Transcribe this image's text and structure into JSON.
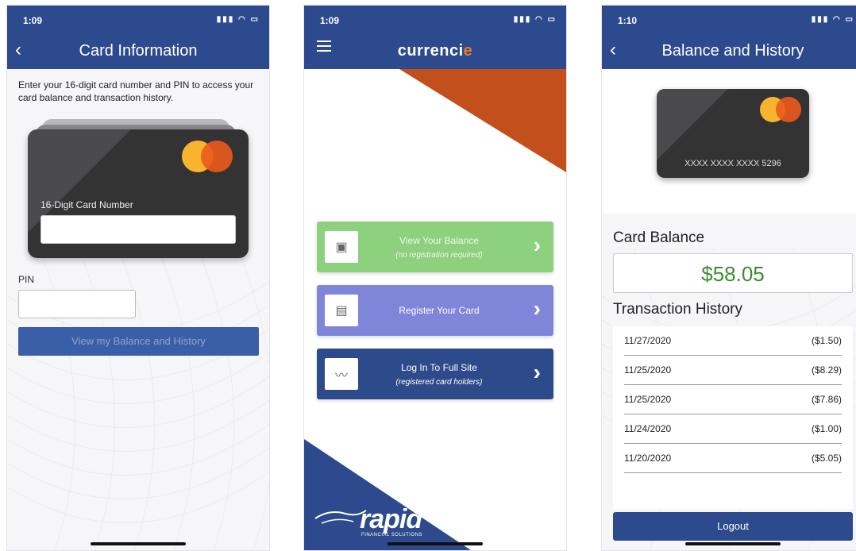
{
  "phone1": {
    "status_time": "1:09",
    "title": "Card Information",
    "intro": "Enter your 16-digit card number and PIN to access your card balance and transaction history.",
    "card_number_label": "16-Digit Card Number",
    "card_number_value": "",
    "pin_label": "PIN",
    "pin_value": "",
    "submit_label": "View my Balance and History"
  },
  "phone2": {
    "status_time": "1:09",
    "brand": "currenci",
    "brand_accent": "e",
    "tiles": [
      {
        "label": "View Your Balance",
        "sub": "(no registration required)"
      },
      {
        "label": "Register Your Card",
        "sub": ""
      },
      {
        "label": "Log In To Full Site",
        "sub": "(registered card holders)"
      }
    ],
    "logo_word": "rapid",
    "logo_sub": "FINANCIAL SOLUTIONS"
  },
  "phone3": {
    "status_time": "1:10",
    "title": "Balance and History",
    "card_masked": "XXXX XXXX XXXX 5296",
    "balance_heading": "Card Balance",
    "balance_value": "$58.05",
    "history_heading": "Transaction History",
    "transactions": [
      {
        "date": "11/27/2020",
        "amount": "($1.50)"
      },
      {
        "date": "11/25/2020",
        "amount": "($8.29)"
      },
      {
        "date": "11/25/2020",
        "amount": "($7.86)"
      },
      {
        "date": "11/24/2020",
        "amount": "($1.00)"
      },
      {
        "date": "11/20/2020",
        "amount": "($5.05)"
      }
    ],
    "logout_label": "Logout"
  },
  "colors": {
    "nav": "#2c4a8d",
    "balance_green": "#3c8c32",
    "tile_green": "#8dd07d",
    "tile_purple": "#7f86da",
    "accent_orange": "#c24f1c"
  },
  "icons": [
    "back-chevron-icon",
    "hamburger-menu-icon",
    "signal-wifi-battery-icon",
    "mastercard-logo",
    "chevron-right-icon"
  ]
}
